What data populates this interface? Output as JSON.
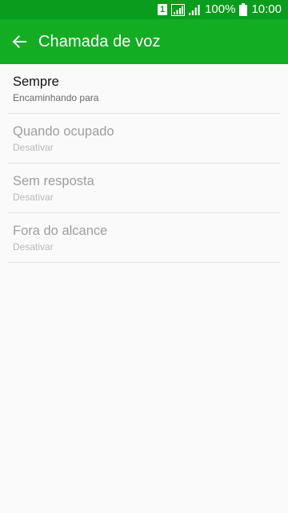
{
  "status_bar": {
    "sim_slot": "1",
    "battery_percent": "100%",
    "time": "10:00"
  },
  "app_bar": {
    "title": "Chamada de voz",
    "back_icon": "arrow-left-icon",
    "background": "#13ad23"
  },
  "list": {
    "items": [
      {
        "title": "Sempre",
        "summary": "Encaminhando para",
        "enabled": true
      },
      {
        "title": "Quando ocupado",
        "summary": "Desativar",
        "enabled": false
      },
      {
        "title": "Sem resposta",
        "summary": "Desativar",
        "enabled": false
      },
      {
        "title": "Fora do alcance",
        "summary": "Desativar",
        "enabled": false
      }
    ]
  }
}
